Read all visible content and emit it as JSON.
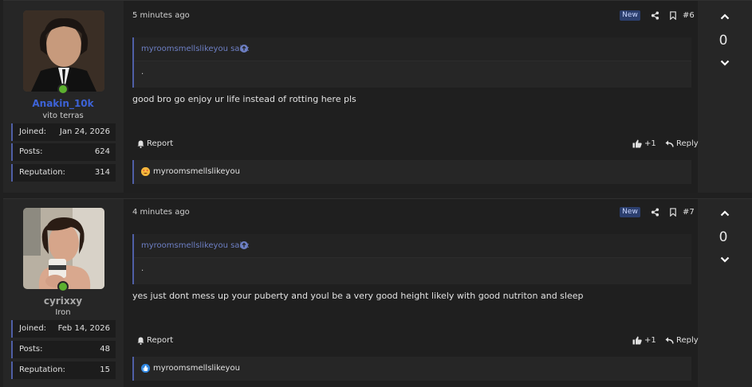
{
  "posts": [
    {
      "author": {
        "username": "Anakin_10k",
        "username_color": "#3d63d8",
        "title": "vito terras",
        "joined_label": "Joined:",
        "joined_value": "Jan 24, 2026",
        "posts_label": "Posts:",
        "posts_value": "624",
        "rep_label": "Reputation:",
        "rep_value": "314"
      },
      "time": "5 minutes ago",
      "badge": "New",
      "number": "#6",
      "quote": {
        "author": "myroomsmellslikeyou said:",
        "body": "."
      },
      "text": "good bro go enjoy ur life instead of rotting here pls",
      "report_label": "Report",
      "like_label": "+1",
      "reply_label": "Reply",
      "reaction": {
        "icon": "heart-eyes-emoji-icon",
        "user": "myroomsmellslikeyou"
      },
      "votes": "0"
    },
    {
      "author": {
        "username": "cyrixxy",
        "username_color": "#a8a8a8",
        "title": "Iron",
        "joined_label": "Joined:",
        "joined_value": "Feb 14, 2026",
        "posts_label": "Posts:",
        "posts_value": "48",
        "rep_label": "Reputation:",
        "rep_value": "15"
      },
      "time": "4 minutes ago",
      "badge": "New",
      "number": "#7",
      "quote": {
        "author": "myroomsmellslikeyou said:",
        "body": "."
      },
      "text": "yes just dont mess up your puberty and youl be a very good height likely with good nutriton and sleep",
      "report_label": "Report",
      "like_label": "+1",
      "reply_label": "Reply",
      "reaction": {
        "icon": "like-emoji-icon",
        "user": "myroomsmellslikeyou"
      },
      "votes": "0"
    }
  ],
  "colors": {
    "accent": "#4f5fa6",
    "online": "#5cb02f",
    "link": "#6d7fc4"
  }
}
